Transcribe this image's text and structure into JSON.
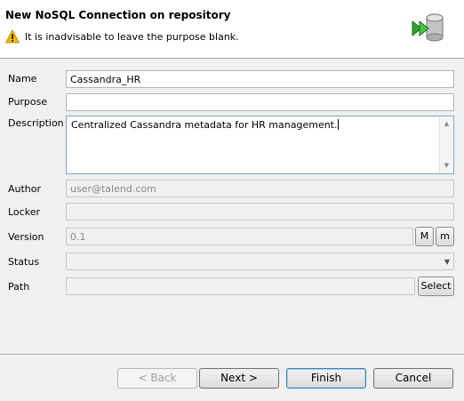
{
  "header": {
    "title": "New NoSQL Connection on repository",
    "message": "It is inadvisable to leave the purpose blank."
  },
  "form": {
    "name": {
      "label": "Name",
      "value": "Cassandra_HR"
    },
    "purpose": {
      "label": "Purpose",
      "value": ""
    },
    "description": {
      "label": "Description",
      "value": "Centralized Cassandra metadata for HR management."
    },
    "author": {
      "label": "Author",
      "value": "user@talend.com"
    },
    "locker": {
      "label": "Locker",
      "value": ""
    },
    "version": {
      "label": "Version",
      "value": "0.1",
      "major_label": "M",
      "minor_label": "m"
    },
    "status": {
      "label": "Status",
      "value": ""
    },
    "path": {
      "label": "Path",
      "value": "",
      "select_label": "Select"
    }
  },
  "buttons": {
    "back": "< Back",
    "next": "Next >",
    "finish": "Finish",
    "cancel": "Cancel"
  },
  "colors": {
    "accent": "#3c7fb1",
    "warning": "#f2b900"
  }
}
